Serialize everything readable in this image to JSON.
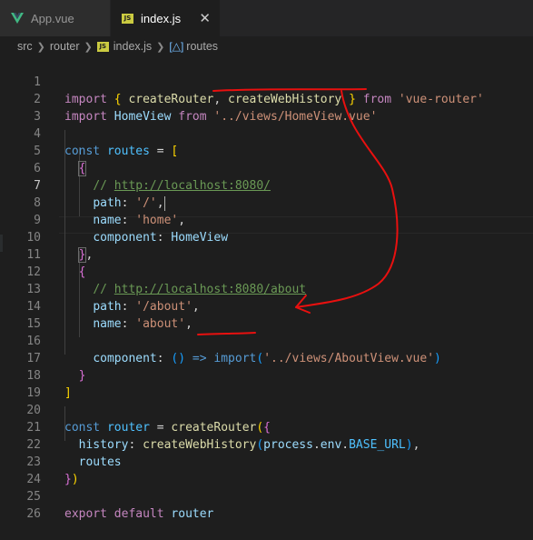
{
  "tabs": [
    {
      "label": "App.vue",
      "icon": "vue-file-icon",
      "active": false
    },
    {
      "label": "index.js",
      "icon": "js-file-icon",
      "active": true,
      "close": "✕"
    }
  ],
  "js_badge": "JS",
  "breadcrumb": {
    "items": [
      "src",
      "router",
      "index.js",
      "routes"
    ]
  },
  "editor": {
    "current_line": 7,
    "line_numbers": [
      "1",
      "2",
      "3",
      "4",
      "5",
      "6",
      "7",
      "8",
      "9",
      "10",
      "11",
      "12",
      "13",
      "14",
      "15",
      "16",
      "17",
      "18",
      "19",
      "20",
      "21",
      "22",
      "23",
      "24",
      "25",
      "26"
    ],
    "tokens": {
      "import": "import",
      "from": "from",
      "const": "const",
      "export": "export",
      "default": "default",
      "createRouter": "createRouter",
      "createWebHistory": "createWebHistory",
      "HomeView": "HomeView",
      "routes": "routes",
      "router": "router",
      "path": "path",
      "name": "name",
      "component": "component",
      "history": "history",
      "process": "process",
      "env": "env",
      "BASE_URL": "BASE_URL",
      "vue_router_str": "'vue-router'",
      "homeview_path": "'../views/HomeView.vue'",
      "comment_slashes": "// ",
      "url_home": "http://localhost:8080/",
      "url_about": "http://localhost:8080/about",
      "slash_str": "'/'",
      "home_str": "'home'",
      "about_path_str": "'/about'",
      "about_str": "'about'",
      "aboutview_path": "'../views/AboutView.vue'",
      "arrow": "=>"
    }
  },
  "colors": {
    "background": "#1e1e1e",
    "keyword": "#c586c0",
    "string": "#ce9178",
    "variable": "#9cdcfe",
    "function": "#dcdcaa",
    "comment": "#6a9955",
    "annotation": "#e8100f"
  }
}
